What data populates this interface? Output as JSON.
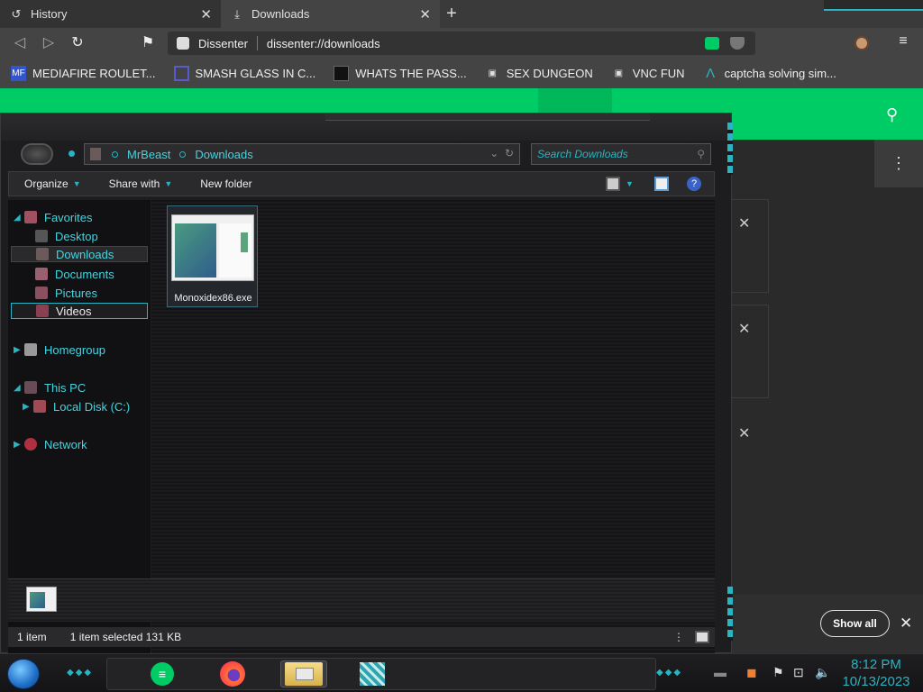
{
  "browser": {
    "tabs": [
      {
        "icon": "history-icon",
        "title": "History",
        "close": "✕"
      },
      {
        "icon": "download-icon",
        "title": "Downloads",
        "close": "✕"
      }
    ],
    "new_tab": "+",
    "omnibox": {
      "site_name": "Dissenter",
      "url": "dissenter://downloads"
    },
    "bookmarks": [
      {
        "label": "MEDIAFIRE ROULET...",
        "icon_text": "MF\nT",
        "color": "#3355cc"
      },
      {
        "label": "SMASH GLASS IN C...",
        "icon_text": "",
        "color": "#5a5acf"
      },
      {
        "label": "WHATS THE PASS...",
        "icon_text": "",
        "color": "#ffffff"
      },
      {
        "label": "SEX DUNGEON",
        "icon_text": "",
        "color": "#dddddd"
      },
      {
        "label": "VNC FUN",
        "icon_text": "",
        "color": "#dddddd"
      },
      {
        "label": "captcha solving sim...",
        "icon_text": "",
        "color": "#2ab3c0"
      }
    ]
  },
  "dissenter_page": {
    "accent": "#00cc66",
    "show_all_label": "Show all"
  },
  "explorer": {
    "breadcrumbs": [
      "MrBeast",
      "Downloads"
    ],
    "search_placeholder": "Search Downloads",
    "commands": [
      "Organize",
      "Share with",
      "New folder"
    ],
    "nav": {
      "favorites": "Favorites",
      "desktop": "Desktop",
      "downloads": "Downloads",
      "documents": "Documents",
      "pictures": "Pictures",
      "videos": "Videos",
      "homegroup": "Homegroup",
      "this_pc": "This PC",
      "local_disk": "Local Disk (C:)",
      "network": "Network"
    },
    "files": [
      {
        "name": "Monoxidex86.exe"
      }
    ],
    "status": {
      "count": "1 item",
      "selection": "1 item selected  131 KB"
    },
    "accent": "#2ab3c0"
  },
  "taskbar": {
    "clock_time": "8:12 PM",
    "clock_date": "10/13/2023"
  }
}
